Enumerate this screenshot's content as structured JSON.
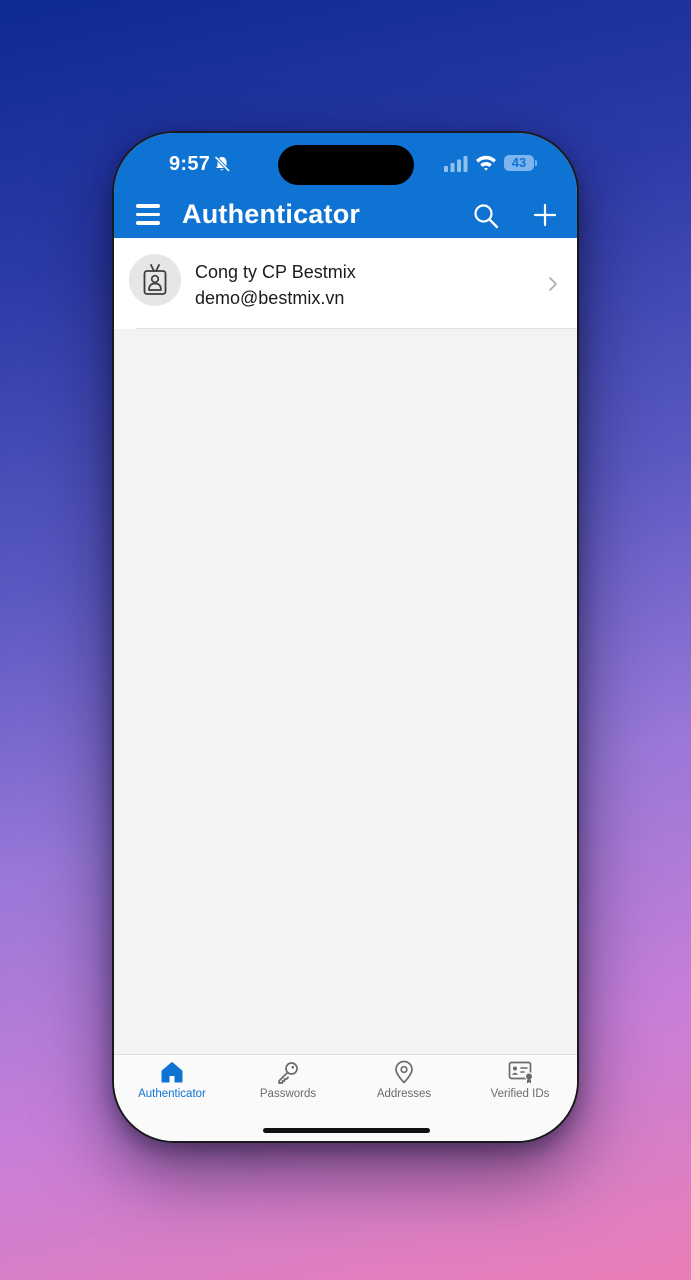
{
  "status_bar": {
    "time": "9:57",
    "battery": "43",
    "icons": [
      "bell-off-icon",
      "cellular-signal-icon",
      "wifi-icon",
      "battery-icon"
    ]
  },
  "header": {
    "title": "Authenticator",
    "menu_icon": "hamburger-menu-icon",
    "search_icon": "search-icon",
    "add_icon": "plus-icon"
  },
  "accounts": [
    {
      "name": "Cong ty CP Bestmix",
      "email": "demo@bestmix.vn",
      "icon": "id-badge-icon"
    }
  ],
  "tabs": [
    {
      "label": "Authenticator",
      "icon": "home-icon",
      "active": true
    },
    {
      "label": "Passwords",
      "icon": "key-icon",
      "active": false
    },
    {
      "label": "Addresses",
      "icon": "location-pin-icon",
      "active": false
    },
    {
      "label": "Verified IDs",
      "icon": "verified-id-card-icon",
      "active": false
    }
  ],
  "colors": {
    "accent": "#0f73d4",
    "background": "#f3f3f3",
    "tab_inactive": "#6b6b6b"
  }
}
